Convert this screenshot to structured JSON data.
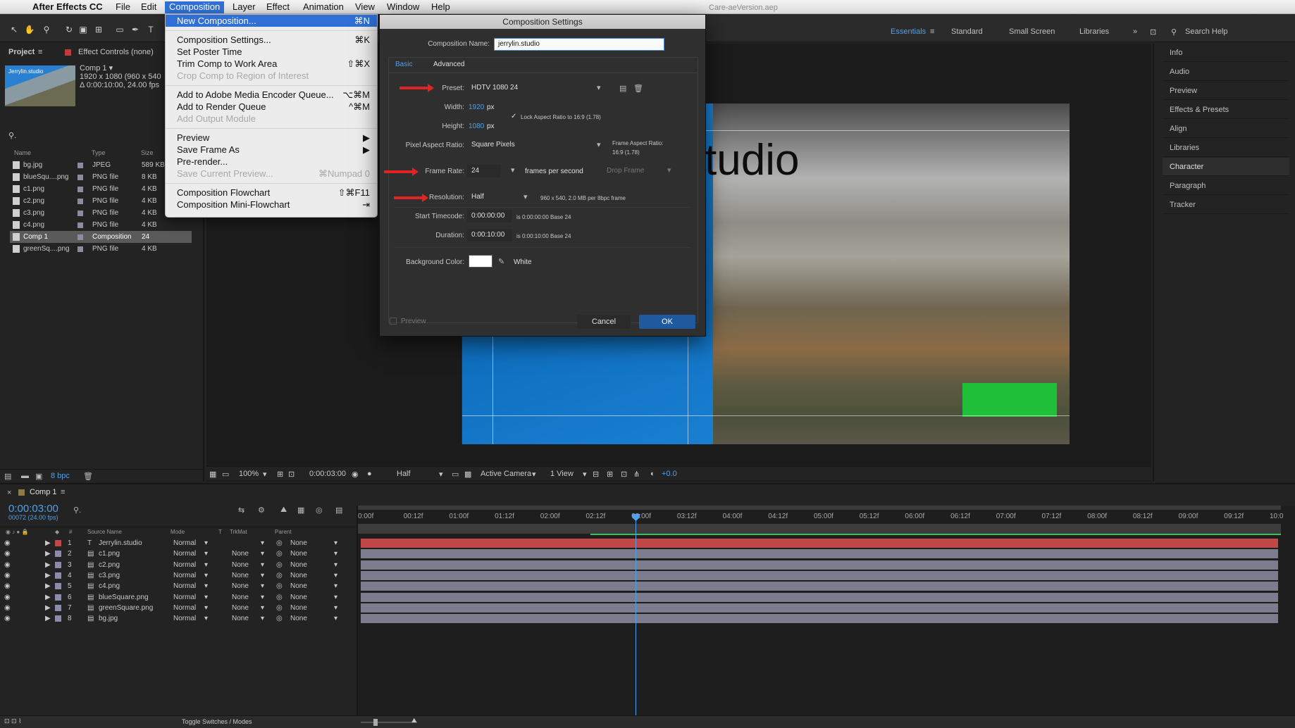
{
  "menubar": {
    "app_name": "After Effects CC",
    "items": [
      "File",
      "Edit",
      "Composition",
      "Layer",
      "Effect",
      "Animation",
      "View",
      "Window",
      "Help"
    ],
    "file_path": "Care-aeVersion.aep"
  },
  "workspace": {
    "items": [
      "Essentials",
      "Standard",
      "Small Screen",
      "Libraries"
    ],
    "active": "Essentials",
    "search_placeholder": "Search Help"
  },
  "project_panel": {
    "tab_project": "Project",
    "tab_effects": "Effect Controls (none)",
    "thumb_text": "Jerrylin.studio",
    "comp_name": "Comp 1 ▾",
    "comp_info_1": "1920 x 1080  (960 x 540",
    "comp_info_2": "Δ 0:00:10:00, 24.00 fps",
    "col_name": "Name",
    "col_type": "Type",
    "col_size": "Size",
    "bpc": "8 bpc",
    "rows": [
      {
        "name": "bg.jpg",
        "type": "JPEG",
        "size": "589 KB"
      },
      {
        "name": "blueSqu....png",
        "type": "PNG file",
        "size": "8 KB"
      },
      {
        "name": "c1.png",
        "type": "PNG file",
        "size": "4 KB"
      },
      {
        "name": "c2.png",
        "type": "PNG file",
        "size": "4 KB"
      },
      {
        "name": "c3.png",
        "type": "PNG file",
        "size": "4 KB"
      },
      {
        "name": "c4.png",
        "type": "PNG file",
        "size": "4 KB"
      },
      {
        "name": "Comp 1",
        "type": "Composition",
        "size": "24"
      },
      {
        "name": "greenSq....png",
        "type": "PNG file",
        "size": "4 KB"
      }
    ]
  },
  "comp_menu": {
    "items": [
      {
        "label": "New Composition...",
        "shortcut": "⌘N"
      },
      {
        "label": "Composition Settings...",
        "shortcut": "⌘K"
      },
      {
        "label": "Set Poster Time",
        "shortcut": ""
      },
      {
        "label": "Trim Comp to Work Area",
        "shortcut": "⇧⌘X"
      },
      {
        "label": "Crop Comp to Region of Interest",
        "shortcut": ""
      },
      {
        "label": "Add to Adobe Media Encoder Queue...",
        "shortcut": "⌥⌘M"
      },
      {
        "label": "Add to Render Queue",
        "shortcut": "^⌘M"
      },
      {
        "label": "Add Output Module",
        "shortcut": ""
      },
      {
        "label": "Preview",
        "shortcut": "▶"
      },
      {
        "label": "Save Frame As",
        "shortcut": "▶"
      },
      {
        "label": "Pre-render...",
        "shortcut": ""
      },
      {
        "label": "Save Current Preview...",
        "shortcut": "⌘Numpad 0"
      },
      {
        "label": "Composition Flowchart",
        "shortcut": "⇧⌘F11"
      },
      {
        "label": "Composition Mini-Flowchart",
        "shortcut": "⇥"
      }
    ]
  },
  "dialog": {
    "title": "Composition Settings",
    "comp_name_label": "Composition Name:",
    "comp_name_value": "jerrylin.studio",
    "tab_basic": "Basic",
    "tab_advanced": "Advanced",
    "preset_label": "Preset:",
    "preset_value": "HDTV 1080 24",
    "width_label": "Width:",
    "width_value": "1920",
    "height_label": "Height:",
    "height_value": "1080",
    "px": "px",
    "lock_aspect": "Lock Aspect Ratio to 16:9 (1.78)",
    "par_label": "Pixel Aspect Ratio:",
    "par_value": "Square Pixels",
    "frame_aspect_1": "Frame Aspect Ratio:",
    "frame_aspect_2": "16:9 (1.78)",
    "framerate_label": "Frame Rate:",
    "framerate_value": "24",
    "fps_text": "frames per second",
    "drop_frame": "Drop Frame",
    "resolution_label": "Resolution:",
    "resolution_value": "Half",
    "resolution_info": "960 x 540, 2.0 MB per 8bpc frame",
    "start_tc_label": "Start Timecode:",
    "start_tc_value": "0:00:00:00",
    "start_tc_info": "is 0:00:00:00  Base 24",
    "duration_label": "Duration:",
    "duration_value": "0:00:10:00",
    "duration_info": "is 0:00:10:00  Base 24",
    "bg_label": "Background Color:",
    "bg_name": "White",
    "preview": "Preview",
    "cancel": "Cancel",
    "ok": "OK"
  },
  "viewer": {
    "studio_text": "tudio",
    "zoom": "100%",
    "timecode": "0:00:03:00",
    "resolution": "Half",
    "camera": "Active Camera",
    "views": "1 View",
    "exposure": "+0.0"
  },
  "right_panel": {
    "items": [
      "Info",
      "Audio",
      "Preview",
      "Effects & Presets",
      "Align",
      "Libraries",
      "Character",
      "Paragraph",
      "Tracker"
    ]
  },
  "timeline": {
    "tab": "Comp 1",
    "timecode": "0:00:03:00",
    "frames": "00072 (24.00 fps)",
    "col_source": "Source Name",
    "col_mode": "Mode",
    "col_t": "T",
    "col_trkmat": "TrkMat",
    "col_parent": "Parent",
    "ticks": [
      "0:00f",
      "00:12f",
      "01:00f",
      "01:12f",
      "02:00f",
      "02:12f",
      "03:00f",
      "03:12f",
      "04:00f",
      "04:12f",
      "05:00f",
      "05:12f",
      "06:00f",
      "06:12f",
      "07:00f",
      "07:12f",
      "08:00f",
      "08:12f",
      "09:00f",
      "09:12f",
      "10:0"
    ],
    "layers": [
      {
        "num": "1",
        "name": "Jerrylin.studio",
        "mode": "Normal",
        "trkmat": "",
        "parent": "None"
      },
      {
        "num": "2",
        "name": "c1.png",
        "mode": "Normal",
        "trkmat": "None",
        "parent": "None"
      },
      {
        "num": "3",
        "name": "c2.png",
        "mode": "Normal",
        "trkmat": "None",
        "parent": "None"
      },
      {
        "num": "4",
        "name": "c3.png",
        "mode": "Normal",
        "trkmat": "None",
        "parent": "None"
      },
      {
        "num": "5",
        "name": "c4.png",
        "mode": "Normal",
        "trkmat": "None",
        "parent": "None"
      },
      {
        "num": "6",
        "name": "blueSquare.png",
        "mode": "Normal",
        "trkmat": "None",
        "parent": "None"
      },
      {
        "num": "7",
        "name": "greenSquare.png",
        "mode": "Normal",
        "trkmat": "None",
        "parent": "None"
      },
      {
        "num": "8",
        "name": "bg.jpg",
        "mode": "Normal",
        "trkmat": "None",
        "parent": "None"
      }
    ]
  },
  "status_bar": {
    "toggle": "Toggle Switches / Modes"
  }
}
